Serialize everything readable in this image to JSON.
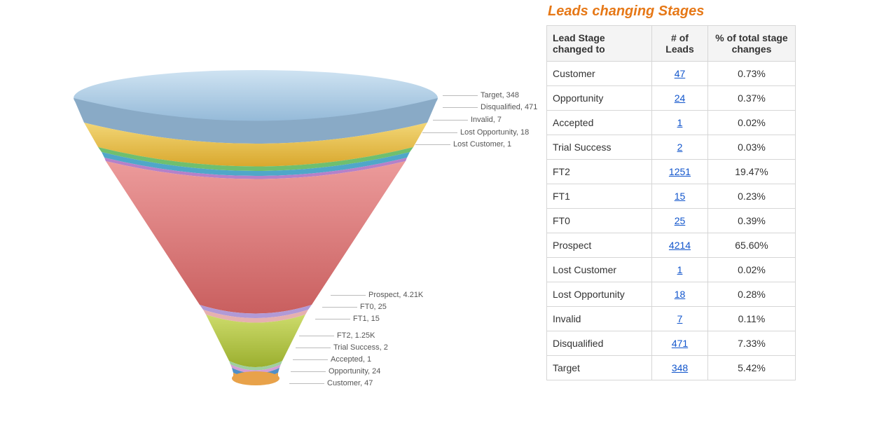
{
  "title": "Leads changing Stages",
  "table": {
    "headers": [
      "Lead Stage changed to",
      "# of Leads",
      "% of total stage changes"
    ],
    "rows": [
      {
        "stage": "Customer",
        "leads": "47",
        "pct": "0.73%"
      },
      {
        "stage": "Opportunity",
        "leads": "24",
        "pct": "0.37%"
      },
      {
        "stage": "Accepted",
        "leads": "1",
        "pct": "0.02%"
      },
      {
        "stage": "Trial Success",
        "leads": "2",
        "pct": "0.03%"
      },
      {
        "stage": "FT2",
        "leads": "1251",
        "pct": "19.47%"
      },
      {
        "stage": "FT1",
        "leads": "15",
        "pct": "0.23%"
      },
      {
        "stage": "FT0",
        "leads": "25",
        "pct": "0.39%"
      },
      {
        "stage": "Prospect",
        "leads": "4214",
        "pct": "65.60%"
      },
      {
        "stage": "Lost Customer",
        "leads": "1",
        "pct": "0.02%"
      },
      {
        "stage": "Lost Opportunity",
        "leads": "18",
        "pct": "0.28%"
      },
      {
        "stage": "Invalid",
        "leads": "7",
        "pct": "0.11%"
      },
      {
        "stage": "Disqualified",
        "leads": "471",
        "pct": "7.33%"
      },
      {
        "stage": "Target",
        "leads": "348",
        "pct": "5.42%"
      }
    ]
  },
  "chart_labels": {
    "target": "Target, 348",
    "disqualified": "Disqualified, 471",
    "invalid": "Invalid, 7",
    "lost_opportunity": "Lost Opportunity, 18",
    "lost_customer": "Lost Customer, 1",
    "prospect": "Prospect, 4.21K",
    "ft0": "FT0, 25",
    "ft1": "FT1, 15",
    "ft2": "FT2, 1.25K",
    "trial_success": "Trial Success, 2",
    "accepted": "Accepted, 1",
    "opportunity": "Opportunity, 24",
    "customer": "Customer, 47"
  },
  "chart_data": {
    "type": "funnel",
    "title": "Leads changing Stages",
    "series": [
      {
        "name": "Target",
        "value": 348,
        "pct": 5.42,
        "color": "#a9c9e6"
      },
      {
        "name": "Disqualified",
        "value": 471,
        "pct": 7.33,
        "color": "#e8bf47"
      },
      {
        "name": "Invalid",
        "value": 7,
        "pct": 0.11,
        "color": "#6fbf6f"
      },
      {
        "name": "Lost Opportunity",
        "value": 18,
        "pct": 0.28,
        "color": "#4fa7c9"
      },
      {
        "name": "Lost Customer",
        "value": 1,
        "pct": 0.02,
        "color": "#b581c9"
      },
      {
        "name": "Prospect",
        "value": 4214,
        "pct": 65.6,
        "color": "#e07a7a"
      },
      {
        "name": "FT0",
        "value": 25,
        "pct": 0.39,
        "color": "#b19ad6"
      },
      {
        "name": "FT1",
        "value": 15,
        "pct": 0.23,
        "color": "#e6b0b0"
      },
      {
        "name": "FT2",
        "value": 1251,
        "pct": 19.47,
        "color": "#b7ca4a"
      },
      {
        "name": "Trial Success",
        "value": 2,
        "pct": 0.03,
        "color": "#9fcf9f"
      },
      {
        "name": "Accepted",
        "value": 1,
        "pct": 0.02,
        "color": "#d29fd6"
      },
      {
        "name": "Opportunity",
        "value": 24,
        "pct": 0.37,
        "color": "#4f8fc9"
      },
      {
        "name": "Customer",
        "value": 47,
        "pct": 0.73,
        "color": "#e8a24a"
      }
    ]
  }
}
